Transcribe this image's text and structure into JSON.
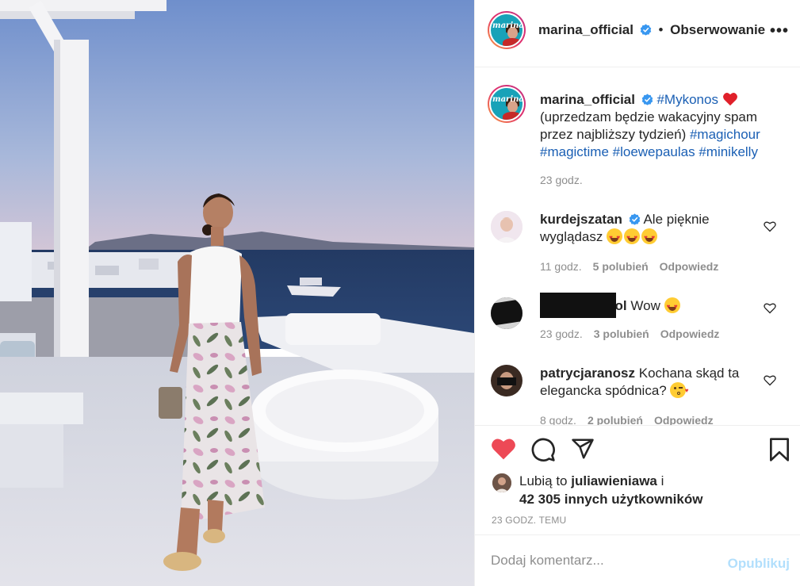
{
  "post": {
    "image_alt": "",
    "author": {
      "username": "marina_official",
      "verified": true,
      "avatar_brand": "marina"
    },
    "follow_state": "Obserwowanie",
    "more_icon": "more-horizontal-icon"
  },
  "caption": {
    "username": "marina_official",
    "hashtag_first": "#Mykonos",
    "text_line": "(uprzedzam będzie wakacyjny spam przez najbliższy tydzień) ",
    "hashtags_rest": "#magichour #magictime #loewepaulas #minikelly",
    "time": "23 godz."
  },
  "comments": [
    {
      "username": "kurdejszatan",
      "verified": true,
      "text": "Ale pięknie wyglądasz",
      "emoji_count": 3,
      "time": "11 godz.",
      "likes": "5 polubień",
      "reply": "Odpowiedz"
    },
    {
      "username": "",
      "username_tail": "ol",
      "text": "Wow",
      "emoji_count": 1,
      "time": "23 godz.",
      "likes": "3 polubień",
      "reply": "Odpowiedz"
    },
    {
      "username": "patrycjaranosz",
      "text": "Kochana skąd ta elegancka spódnica?",
      "emoji_count": 1,
      "time": "8 godz.",
      "likes": "2 polubień",
      "reply": "Odpowiedz"
    }
  ],
  "actions": {
    "like_icon": "heart-filled-icon",
    "comment_icon": "comment-icon",
    "share_icon": "share-icon",
    "save_icon": "bookmark-icon",
    "liked": true
  },
  "likes": {
    "prefix": "Lubią to ",
    "user": "juliawieniawa",
    "suffix": " i",
    "others": "42 305 innych użytkowników"
  },
  "posted_time": "23 GODZ. TEMU",
  "add_comment": {
    "placeholder": "Dodaj komentarz...",
    "publish_label": "Opublikuj"
  },
  "colors": {
    "accent_blue": "#0095f6",
    "publish_disabled": "#b2dffc",
    "like_red": "#ed4956",
    "verified_blue": "#3897f0"
  }
}
